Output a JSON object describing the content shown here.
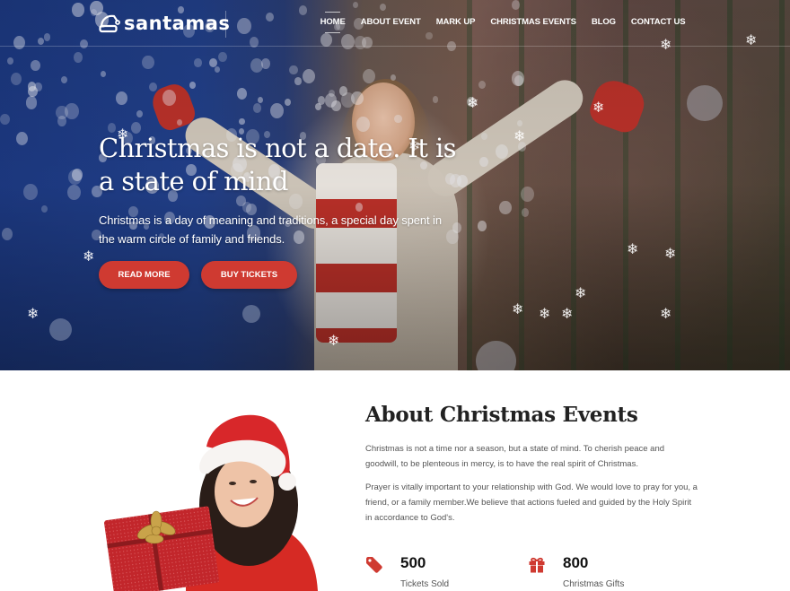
{
  "brand": {
    "logo_text": "santamas",
    "logo_icon": "santa-hat-icon",
    "accent_color": "#cf3a31"
  },
  "nav": {
    "items": [
      {
        "label": "HOME",
        "active": true
      },
      {
        "label": "ABOUT EVENT",
        "active": false
      },
      {
        "label": "MARK UP",
        "active": false
      },
      {
        "label": "CHRISTMAS EVENTS",
        "active": false
      },
      {
        "label": "BLOG",
        "active": false
      },
      {
        "label": "CONTACT US",
        "active": false
      }
    ]
  },
  "hero": {
    "title": "Christmas is not a date. It is a state of mind",
    "subtitle": "Christmas is a day of meaning and traditions, a special day spent in the warm circle of family and friends.",
    "buttons": {
      "read_more": "READ MORE",
      "buy_tickets": "BUY TICKETS"
    }
  },
  "about": {
    "title": "About Christmas Events",
    "paragraphs": [
      "Christmas is not a time nor a season, but a state of mind. To cherish peace and goodwill, to be plenteous in mercy, is to have the real spirit of Christmas.",
      "Prayer is vitally important to your relationship with God. We would love to pray for you, a friend, or a family member.We believe that actions fueled and guided by the Holy Spirit in accordance to God's."
    ],
    "image_alt": "Woman in santa hat holding a red gift box",
    "stats": [
      {
        "icon": "tag-icon",
        "number": "500",
        "label": "Tickets Sold"
      },
      {
        "icon": "gift-icon",
        "number": "800",
        "label": "Christmas Gifts"
      }
    ]
  }
}
